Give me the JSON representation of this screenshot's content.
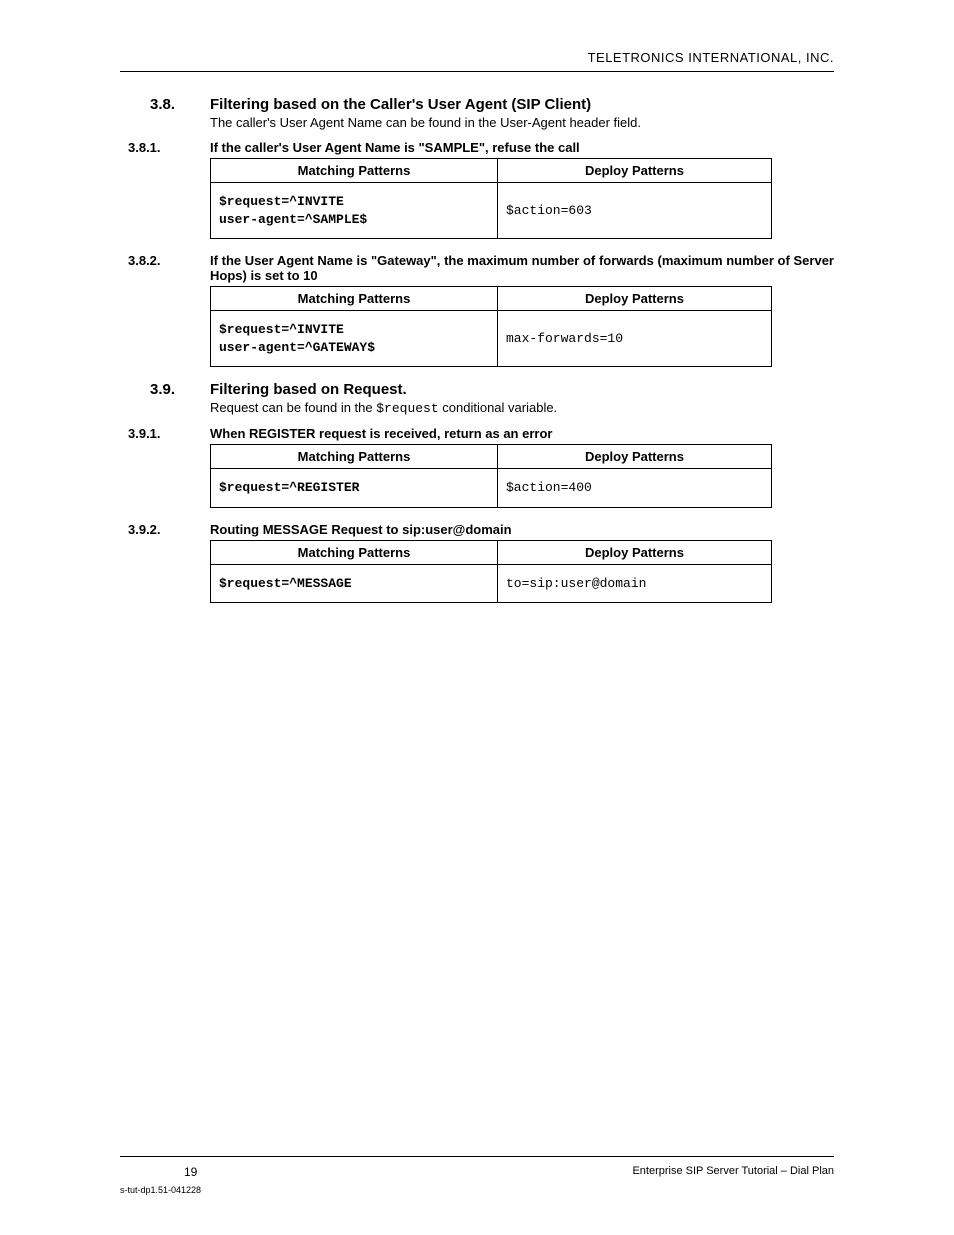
{
  "header": {
    "company": "TELETRONICS INTERNATIONAL, INC."
  },
  "sections": {
    "s38": {
      "num": "3.8.",
      "title": "Filtering based on the Caller's User Agent (SIP Client)",
      "body": "The caller's User Agent Name can be found in the User-Agent header field."
    },
    "s381": {
      "num": "3.8.1.",
      "title": "If the caller's User Agent Name is \"SAMPLE\", refuse the call",
      "table": {
        "h1": "Matching Patterns",
        "h2": "Deploy Patterns",
        "c1": "$request=^INVITE\nuser-agent=^SAMPLE$",
        "c2": "$action=603"
      }
    },
    "s382": {
      "num": "3.8.2.",
      "title": "If the User Agent Name is \"Gateway\", the maximum number of forwards (maximum number of Server Hops) is set to 10",
      "table": {
        "h1": "Matching Patterns",
        "h2": "Deploy Patterns",
        "c1": "$request=^INVITE\nuser-agent=^GATEWAY$",
        "c2": "max-forwards=10"
      }
    },
    "s39": {
      "num": "3.9.",
      "title": "Filtering based on Request.",
      "body_pre": "Request can be found in the ",
      "body_code": "$request",
      "body_post": " conditional variable."
    },
    "s391": {
      "num": "3.9.1.",
      "title": "When REGISTER request is received, return as an error",
      "table": {
        "h1": "Matching Patterns",
        "h2": "Deploy Patterns",
        "c1": "$request=^REGISTER",
        "c2": "$action=400"
      }
    },
    "s392": {
      "num": "3.9.2.",
      "title": "Routing MESSAGE Request to sip:user@domain",
      "table": {
        "h1": "Matching Patterns",
        "h2": "Deploy Patterns",
        "c1": "$request=^MESSAGE",
        "c2": "to=sip:user@domain"
      }
    }
  },
  "footer": {
    "page": "19",
    "doctitle": "Enterprise SIP Server Tutorial – Dial Plan",
    "docid": "s-tut-dp1.51-041228"
  }
}
